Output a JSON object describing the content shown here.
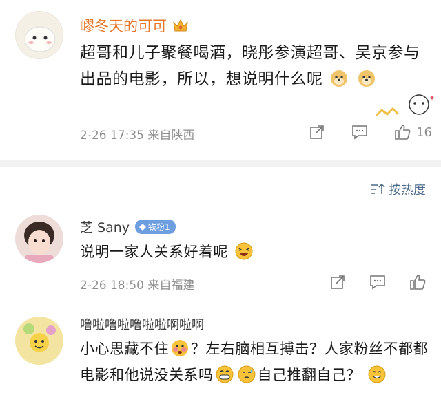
{
  "post": {
    "author": "嵺冬天的可可",
    "text_parts": [
      "超哥和儿子聚餐喝酒，晓彤参演超哥、吴京参与出品的电影，所以，想说明什么呢"
    ],
    "meta": "2-26 17:35 来自陕西",
    "like_count": "16",
    "icons": [
      "share-icon",
      "comment-icon",
      "like-icon"
    ]
  },
  "sort": {
    "label": "按热度"
  },
  "comments": [
    {
      "author": "芝 Sany",
      "badge": "铁粉1",
      "text": "说明一家人关系好着呢",
      "meta": "2-26 18:50 来自福建"
    },
    {
      "author": "噜啦噜啦噜啦啦啊啦啊",
      "text_a": "小心思藏不住",
      "text_b": "？左右脑相互搏击？人家粉丝不都都电影和他说没关系吗",
      "text_c": "自己推翻自己？"
    }
  ],
  "colors": {
    "author_orange": "#e6792c",
    "link_blue": "#4a6a8a",
    "meta_gray": "#8e8e8e"
  }
}
